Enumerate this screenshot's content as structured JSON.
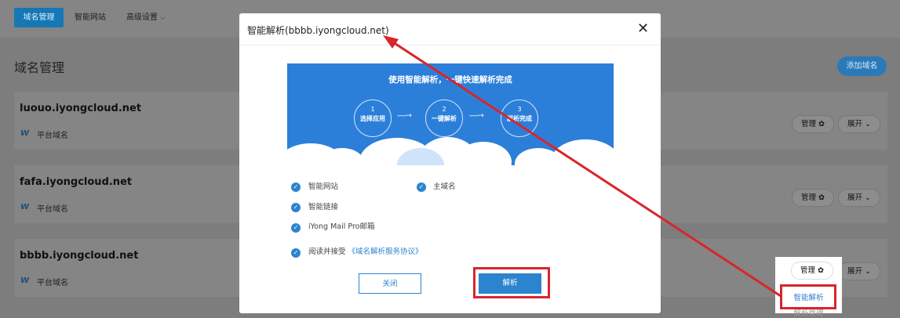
{
  "nav": {
    "tabs": [
      {
        "label": "域名管理"
      },
      {
        "label": "智能网站"
      },
      {
        "label": "高级设置"
      }
    ]
  },
  "page": {
    "title": "域名管理",
    "add_button": "添加域名"
  },
  "domains": [
    {
      "name": "luouo.iyongcloud.net",
      "type": "平台域名"
    },
    {
      "name": "fafa.iyongcloud.net",
      "type": "平台域名"
    },
    {
      "name": "bbbb.iyongcloud.net",
      "type": "平台域名"
    }
  ],
  "row_actions": {
    "manage": "管理",
    "expand": "展开"
  },
  "modal": {
    "title": "智能解析(bbbb.iyongcloud.net)",
    "banner": {
      "headline": "使用智能解析，一键快速解析完成",
      "steps": [
        {
          "num": "1",
          "label": "选择应用"
        },
        {
          "num": "2",
          "label": "一键解析"
        },
        {
          "num": "3",
          "label": "解析完成"
        }
      ]
    },
    "options": {
      "site": "智能网站",
      "main_domain": "主域名",
      "link": "智能链接",
      "mail": "iYong Mail Pro邮箱"
    },
    "agreement": {
      "prefix": "阅读并接受",
      "link": "《域名解析服务协议》"
    },
    "cancel": "关闭",
    "confirm": "解析"
  },
  "dropdown": {
    "button": "管理",
    "item_smart": "智能解析",
    "item_manage": "解析管理"
  },
  "colors": {
    "accent": "#2c84cf",
    "highlight": "#d9252b"
  }
}
